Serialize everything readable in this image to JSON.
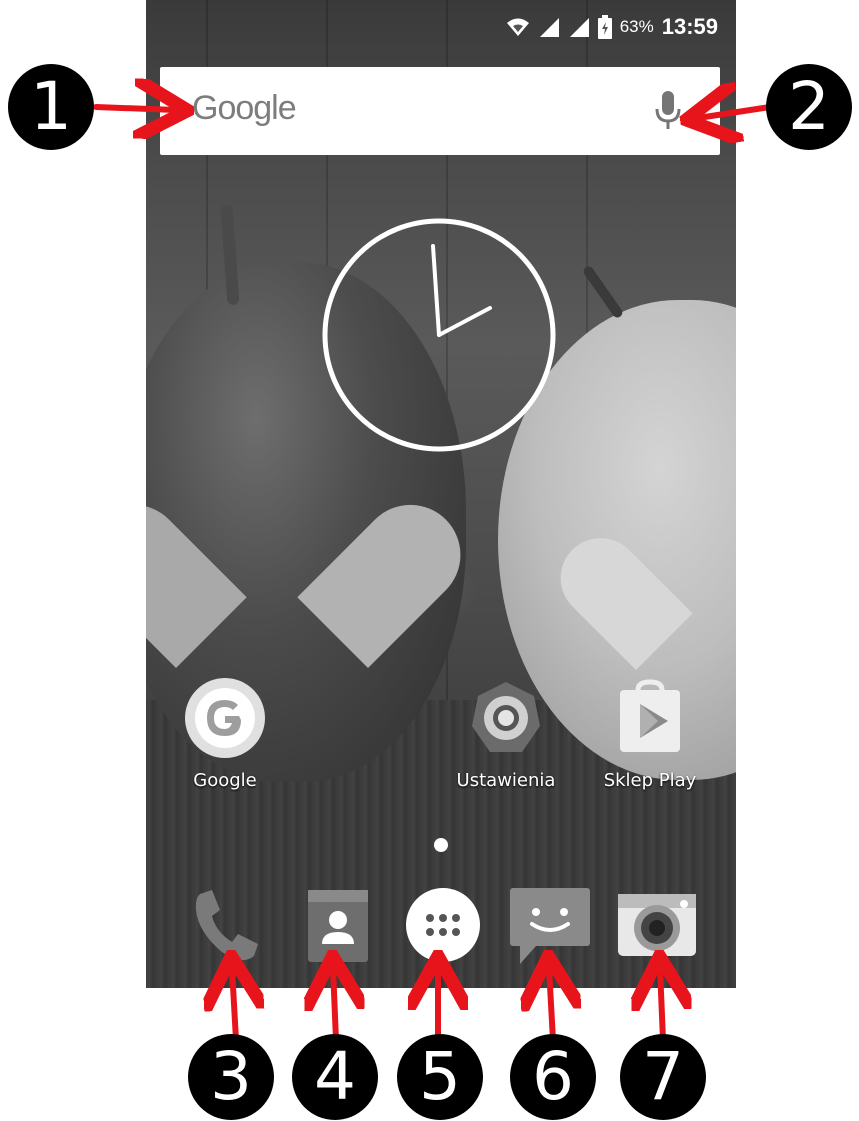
{
  "status_bar": {
    "battery_percent": "63%",
    "time": "13:59"
  },
  "search_bar": {
    "logo_text": "Google",
    "mic_icon": "mic-icon"
  },
  "clock_widget": {
    "type": "analog-clock",
    "time": "13:59"
  },
  "home_apps": [
    {
      "label": "Google",
      "icon": "google-app-icon"
    },
    {
      "label": "Ustawienia",
      "icon": "settings-icon"
    },
    {
      "label": "Sklep Play",
      "icon": "play-store-icon"
    }
  ],
  "page_indicator": {
    "pages": 1,
    "current": 1
  },
  "dock": [
    {
      "icon": "phone-icon"
    },
    {
      "icon": "contacts-icon"
    },
    {
      "icon": "app-drawer-icon"
    },
    {
      "icon": "messages-icon"
    },
    {
      "icon": "camera-icon"
    }
  ],
  "annotations": [
    {
      "number": "1",
      "target": "search-bar"
    },
    {
      "number": "2",
      "target": "mic-icon"
    },
    {
      "number": "3",
      "target": "phone-icon"
    },
    {
      "number": "4",
      "target": "contacts-icon"
    },
    {
      "number": "5",
      "target": "app-drawer-icon"
    },
    {
      "number": "6",
      "target": "messages-icon"
    },
    {
      "number": "7",
      "target": "camera-icon"
    }
  ],
  "colors": {
    "arrow": "#e8141c",
    "callout_bg": "#000000",
    "callout_text": "#ffffff"
  }
}
